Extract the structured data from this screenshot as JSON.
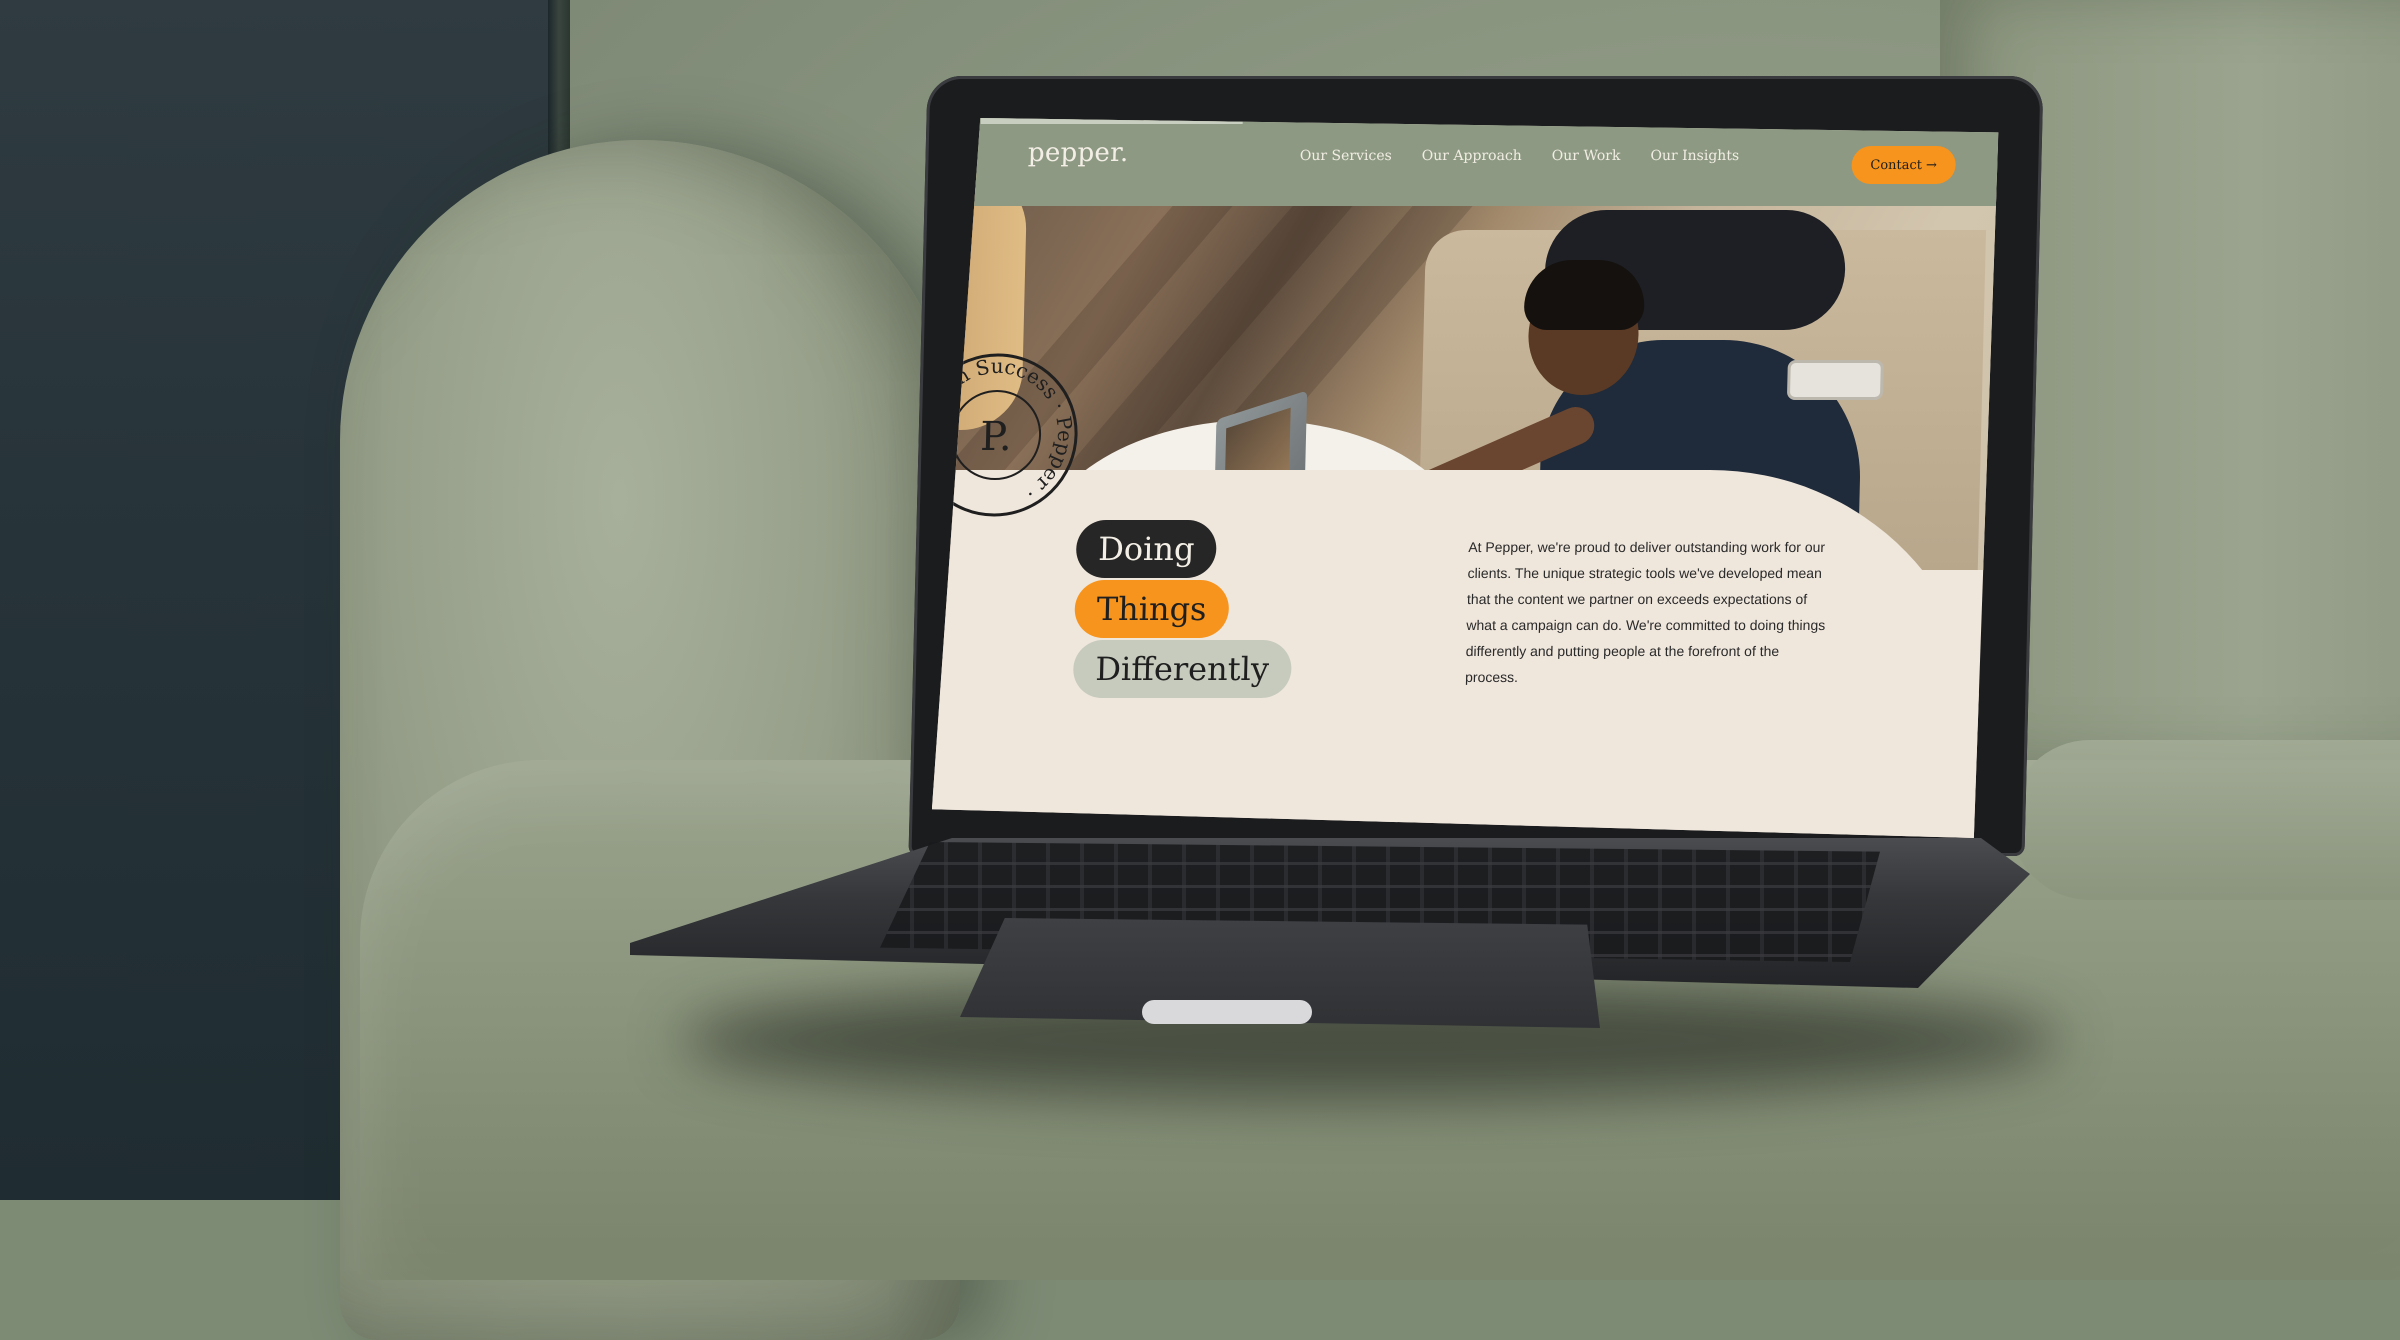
{
  "website": {
    "logo": "pepper.",
    "nav": {
      "links": [
        "Our Services",
        "Our Approach",
        "Our Work",
        "Our Insights"
      ],
      "contact_label": "Contact",
      "contact_arrow": "→"
    },
    "headline": [
      "Doing",
      "Things",
      "Differently"
    ],
    "intro": "At Pepper, we're proud to deliver outstanding work for our clients. The unique strategic tools we've developed mean that the content we partner on exceeds expectations of what a campaign can do. We're committed to doing things differently and putting people at the forefront of the process.",
    "badge": {
      "ring_text": "Design Success · Pepper ·",
      "monogram": "P."
    }
  },
  "colors": {
    "nav_bg": "#8d9982",
    "accent_orange": "#f7941d",
    "content_bg": "#efe6dc",
    "pill_dark": "#262626",
    "pill_sage": "#c6cbbd"
  },
  "icons": [
    "arrow-right-icon",
    "badge-monogram-icon"
  ]
}
